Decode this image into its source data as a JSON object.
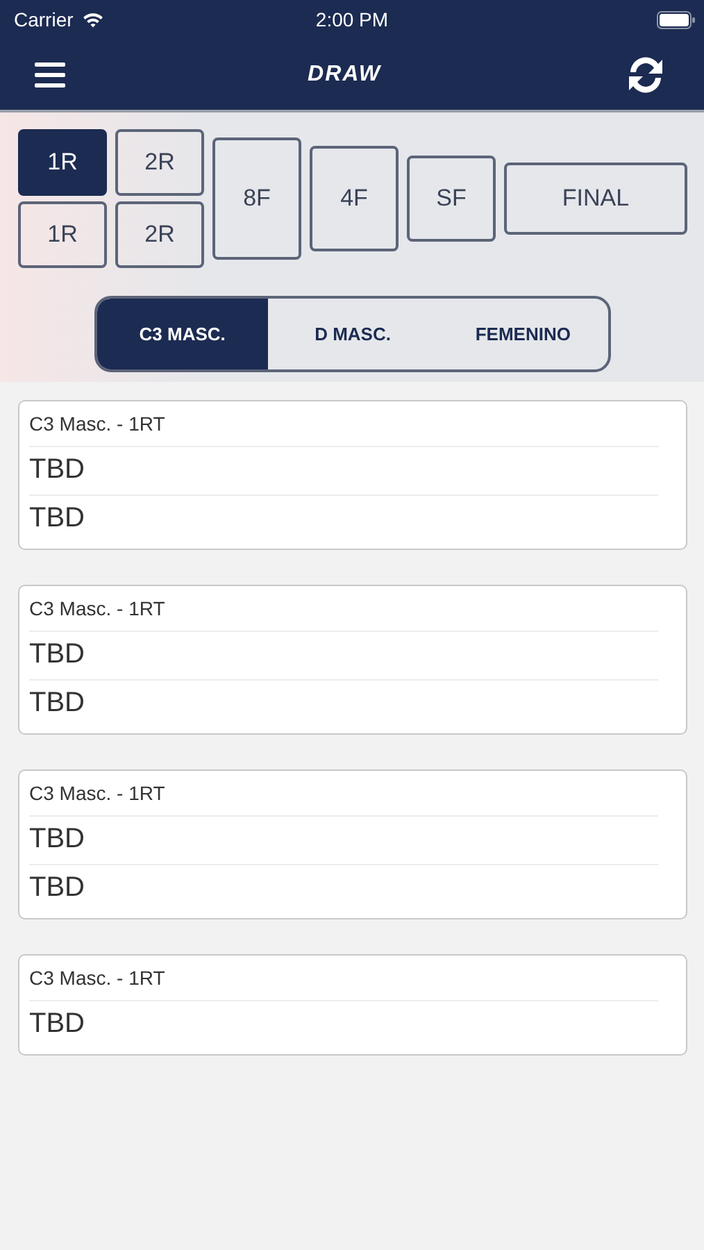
{
  "status_bar": {
    "carrier": "Carrier",
    "time": "2:00 PM"
  },
  "nav": {
    "title": "DRAW"
  },
  "rounds": [
    {
      "buttons": [
        {
          "label": "1R",
          "selected": true
        },
        {
          "label": "1R",
          "selected": false
        }
      ]
    },
    {
      "buttons": [
        {
          "label": "2R",
          "selected": false
        },
        {
          "label": "2R",
          "selected": false
        }
      ]
    },
    {
      "buttons": [
        {
          "label": "8F",
          "selected": false
        }
      ]
    },
    {
      "buttons": [
        {
          "label": "4F",
          "selected": false
        }
      ]
    },
    {
      "buttons": [
        {
          "label": "SF",
          "selected": false
        }
      ]
    },
    {
      "buttons": [
        {
          "label": "FINAL",
          "selected": false
        }
      ]
    }
  ],
  "categories": [
    {
      "label": "C3 MASC.",
      "selected": true
    },
    {
      "label": "D MASC.",
      "selected": false
    },
    {
      "label": "FEMENINO",
      "selected": false
    }
  ],
  "matches": [
    {
      "title": "C3 Masc. - 1RT",
      "players": [
        "TBD",
        "TBD"
      ]
    },
    {
      "title": "C3 Masc. - 1RT",
      "players": [
        "TBD",
        "TBD"
      ]
    },
    {
      "title": "C3 Masc. - 1RT",
      "players": [
        "TBD",
        "TBD"
      ]
    },
    {
      "title": "C3 Masc. - 1RT",
      "players": [
        "TBD"
      ]
    }
  ]
}
